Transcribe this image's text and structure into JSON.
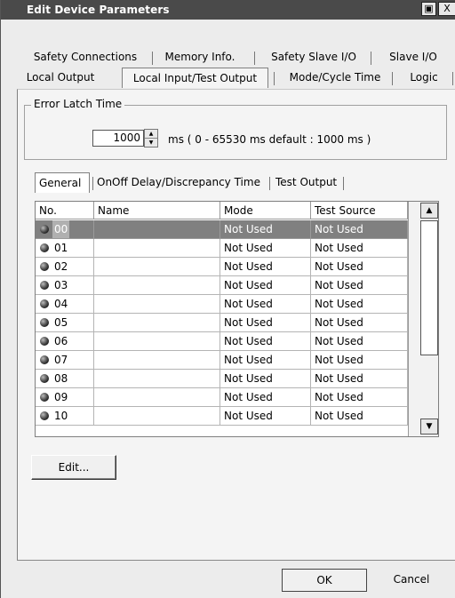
{
  "window": {
    "title": "Edit Device Parameters",
    "restore_glyph": "▣",
    "close_glyph": "X"
  },
  "tabs_row1": [
    "Safety Connections",
    "Memory Info.",
    "Safety Slave I/O",
    "Slave I/O"
  ],
  "tabs_row2": [
    "Local Output",
    "Local Input/Test Output",
    "Mode/Cycle Time",
    "Logic"
  ],
  "active_tab": "Local Input/Test Output",
  "error_latch": {
    "label": "Error Latch Time",
    "value": "1000",
    "range_text": "ms  ( 0 - 65530 ms   default : 1000 ms )"
  },
  "subtabs": [
    "General",
    "OnOff Delay/Discrepancy Time",
    "Test Output"
  ],
  "active_subtab": "General",
  "table": {
    "columns": [
      "No.",
      "Name",
      "Mode",
      "Test Source"
    ],
    "rows": [
      {
        "no": "00",
        "name": "",
        "mode": "Not Used",
        "test_source": "Not Used",
        "selected": true
      },
      {
        "no": "01",
        "name": "",
        "mode": "Not Used",
        "test_source": "Not Used"
      },
      {
        "no": "02",
        "name": "",
        "mode": "Not Used",
        "test_source": "Not Used"
      },
      {
        "no": "03",
        "name": "",
        "mode": "Not Used",
        "test_source": "Not Used"
      },
      {
        "no": "04",
        "name": "",
        "mode": "Not Used",
        "test_source": "Not Used"
      },
      {
        "no": "05",
        "name": "",
        "mode": "Not Used",
        "test_source": "Not Used"
      },
      {
        "no": "06",
        "name": "",
        "mode": "Not Used",
        "test_source": "Not Used"
      },
      {
        "no": "07",
        "name": "",
        "mode": "Not Used",
        "test_source": "Not Used"
      },
      {
        "no": "08",
        "name": "",
        "mode": "Not Used",
        "test_source": "Not Used"
      },
      {
        "no": "09",
        "name": "",
        "mode": "Not Used",
        "test_source": "Not Used"
      },
      {
        "no": "10",
        "name": "",
        "mode": "Not Used",
        "test_source": "Not Used"
      }
    ]
  },
  "buttons": {
    "edit": "Edit...",
    "ok": "OK",
    "cancel": "Cancel"
  },
  "icons": {
    "row_status": "status-dot-icon",
    "scroll_up": "scroll-up-arrow-icon",
    "scroll_down": "scroll-down-arrow-icon",
    "spin_up": "spin-up-icon",
    "spin_down": "spin-down-icon"
  },
  "colors": {
    "titlebar": "#4a4a4a",
    "selected_row": "#808080",
    "panel": "#f4f4f4"
  }
}
